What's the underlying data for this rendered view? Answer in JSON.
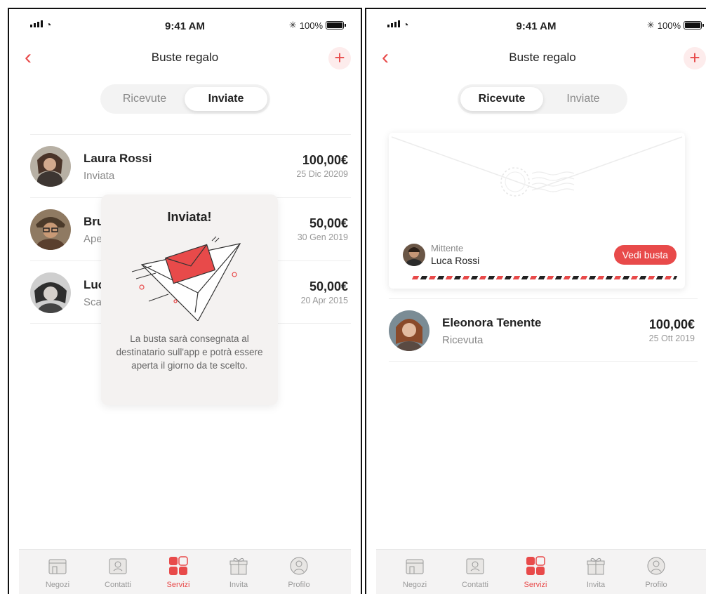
{
  "status": {
    "time": "9:41 AM",
    "battery": "100%"
  },
  "nav": {
    "title": "Buste regalo",
    "back_icon": "chevron-left-icon",
    "add_icon": "plus-icon"
  },
  "segment": {
    "received": "Ricevute",
    "sent": "Inviate"
  },
  "left": {
    "rows": [
      {
        "name": "Laura Rossi",
        "status": "Inviata",
        "amount": "100,00€",
        "date": "25 Dic 20209"
      },
      {
        "name": "Bruno Verdi",
        "status": "Aperta",
        "amount": "50,00€",
        "date": "30 Gen 2019"
      },
      {
        "name": "Lucia Ferri",
        "status": "Scaduta",
        "amount": "50,00€",
        "date": "20 Apr 2015"
      }
    ],
    "popup": {
      "title": "Inviata!",
      "text": "La busta sarà consegnata al destinatario sull'app e potrà essere aperta il giorno da te scelto."
    }
  },
  "right": {
    "envelope": {
      "sender_label": "Mittente",
      "sender_name": "Luca Rossi",
      "button": "Vedi busta"
    },
    "rows": [
      {
        "name": "Eleonora Tenente",
        "status": "Ricevuta",
        "amount": "100,00€",
        "date": "25 Ott 2019"
      }
    ]
  },
  "tabs": [
    {
      "label": "Negozi",
      "icon": "shop-icon"
    },
    {
      "label": "Contatti",
      "icon": "contacts-icon"
    },
    {
      "label": "Servizi",
      "icon": "grid-icon"
    },
    {
      "label": "Invita",
      "icon": "gift-icon"
    },
    {
      "label": "Profilo",
      "icon": "profile-icon"
    }
  ],
  "colors": {
    "accent": "#e84a4a",
    "muted": "#888888"
  }
}
